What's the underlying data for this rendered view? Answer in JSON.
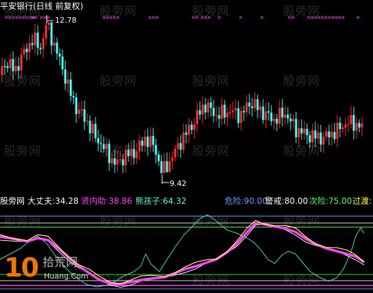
{
  "top_panel": {
    "title": "平安银行(日线 前复权)",
    "high_label": "12.78",
    "low_label": "9.42"
  },
  "watermark": {
    "text": "股旁网"
  },
  "indicator": {
    "name": "股旁网",
    "items": [
      {
        "label": "大丈夫:",
        "value": "34.28",
        "color": "#ffffff"
      },
      {
        "label": "贤内助:",
        "value": "38.86",
        "color": "#ff44ff"
      },
      {
        "label": "熊孩子:",
        "value": "64.32",
        "color": "#66ffcc"
      }
    ],
    "levels": [
      {
        "label": "危险:",
        "value": "90.00",
        "color": "#7799ff"
      },
      {
        "label": "警戒:",
        "value": "80.00",
        "color": "#ffffff"
      },
      {
        "label": "次险:",
        "value": "75.00",
        "color": "#66ff66"
      },
      {
        "label": "过渡:",
        "value": "",
        "color": "#ffff44"
      }
    ]
  },
  "logo": {
    "number": "10",
    "text": "拾荒网",
    "url": "Huang.Com"
  },
  "colors": {
    "background": "#000000",
    "up_candle": "#ff3333",
    "down_candle": "#55ffff",
    "marker": "#ff55ff",
    "line_white": "#ffffff",
    "line_magenta": "#ff44ff",
    "line_cyan": "#55ddbb",
    "line_yellow": "#ffff55"
  }
}
